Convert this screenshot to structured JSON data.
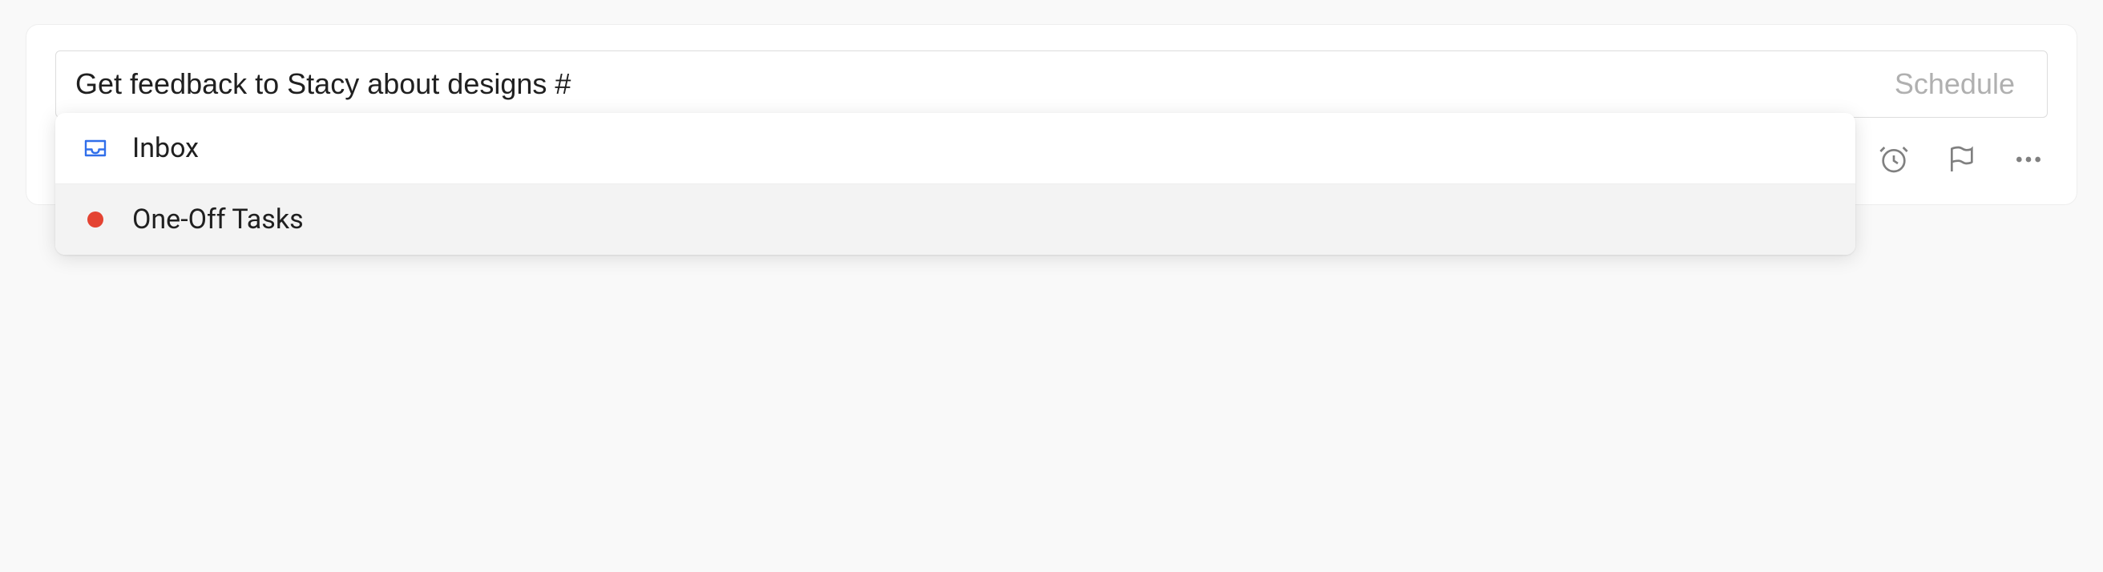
{
  "task": {
    "input_value": "Get feedback to Stacy about designs #",
    "schedule_label": "Schedule"
  },
  "dropdown": {
    "items": [
      {
        "label": "Inbox",
        "icon": "inbox",
        "highlighted": false
      },
      {
        "label": "One-Off Tasks",
        "icon": "red-dot",
        "highlighted": true
      }
    ]
  },
  "colors": {
    "accent_red": "#e44332",
    "icon_gray": "#808080",
    "inbox_blue": "#316fea"
  },
  "actions": {
    "reminder": "reminder",
    "flag": "flag",
    "more": "more"
  }
}
